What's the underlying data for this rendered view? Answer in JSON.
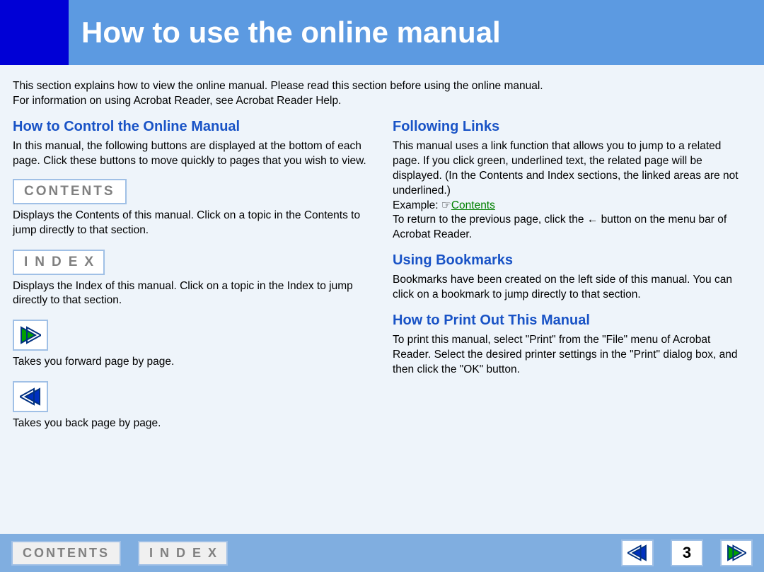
{
  "header": {
    "title": "How to use the online manual"
  },
  "intro": {
    "line1": "This section explains how to view the online manual. Please read this section before using the online manual.",
    "line2": "For information on using Acrobat Reader, see Acrobat Reader Help."
  },
  "left": {
    "h1": "How to Control the Online Manual",
    "p1": "In this manual, the following buttons are displayed at the bottom of each page. Click these buttons to move quickly to pages that you wish to view.",
    "contents_label": "CONTENTS",
    "contents_desc": "Displays the Contents of this manual. Click on a topic in the Contents to jump directly to that section.",
    "index_label": "INDEX",
    "index_desc": "Displays the Index of this manual. Click on a topic in the Index to jump directly to that section.",
    "forward_desc": "Takes you forward page by page.",
    "back_desc": "Takes you back page by page."
  },
  "right": {
    "h1": "Following Links",
    "p1a": "This manual uses a link function that allows you to jump to a related page. If you click green, underlined text, the related page will be displayed. (In the Contents and Index sections, the linked areas are not underlined.)",
    "example_prefix": "Example: ☞",
    "example_link": "Contents",
    "p1b": "To return to the previous page, click the ← button on the menu bar of Acrobat Reader.",
    "h2": "Using Bookmarks",
    "p2": "Bookmarks have been created on the left side of this manual. You can click on a bookmark to jump directly to that section.",
    "h3": "How to Print Out This Manual",
    "p3": "To print this manual, select \"Print\" from the \"File\" menu of Acrobat Reader. Select the desired printer settings in the \"Print\" dialog box, and then click the \"OK\" button."
  },
  "footer": {
    "contents": "CONTENTS",
    "index": "INDEX",
    "page": "3"
  },
  "icons": {
    "forward": "forward-arrow-icon",
    "back": "back-arrow-icon"
  }
}
